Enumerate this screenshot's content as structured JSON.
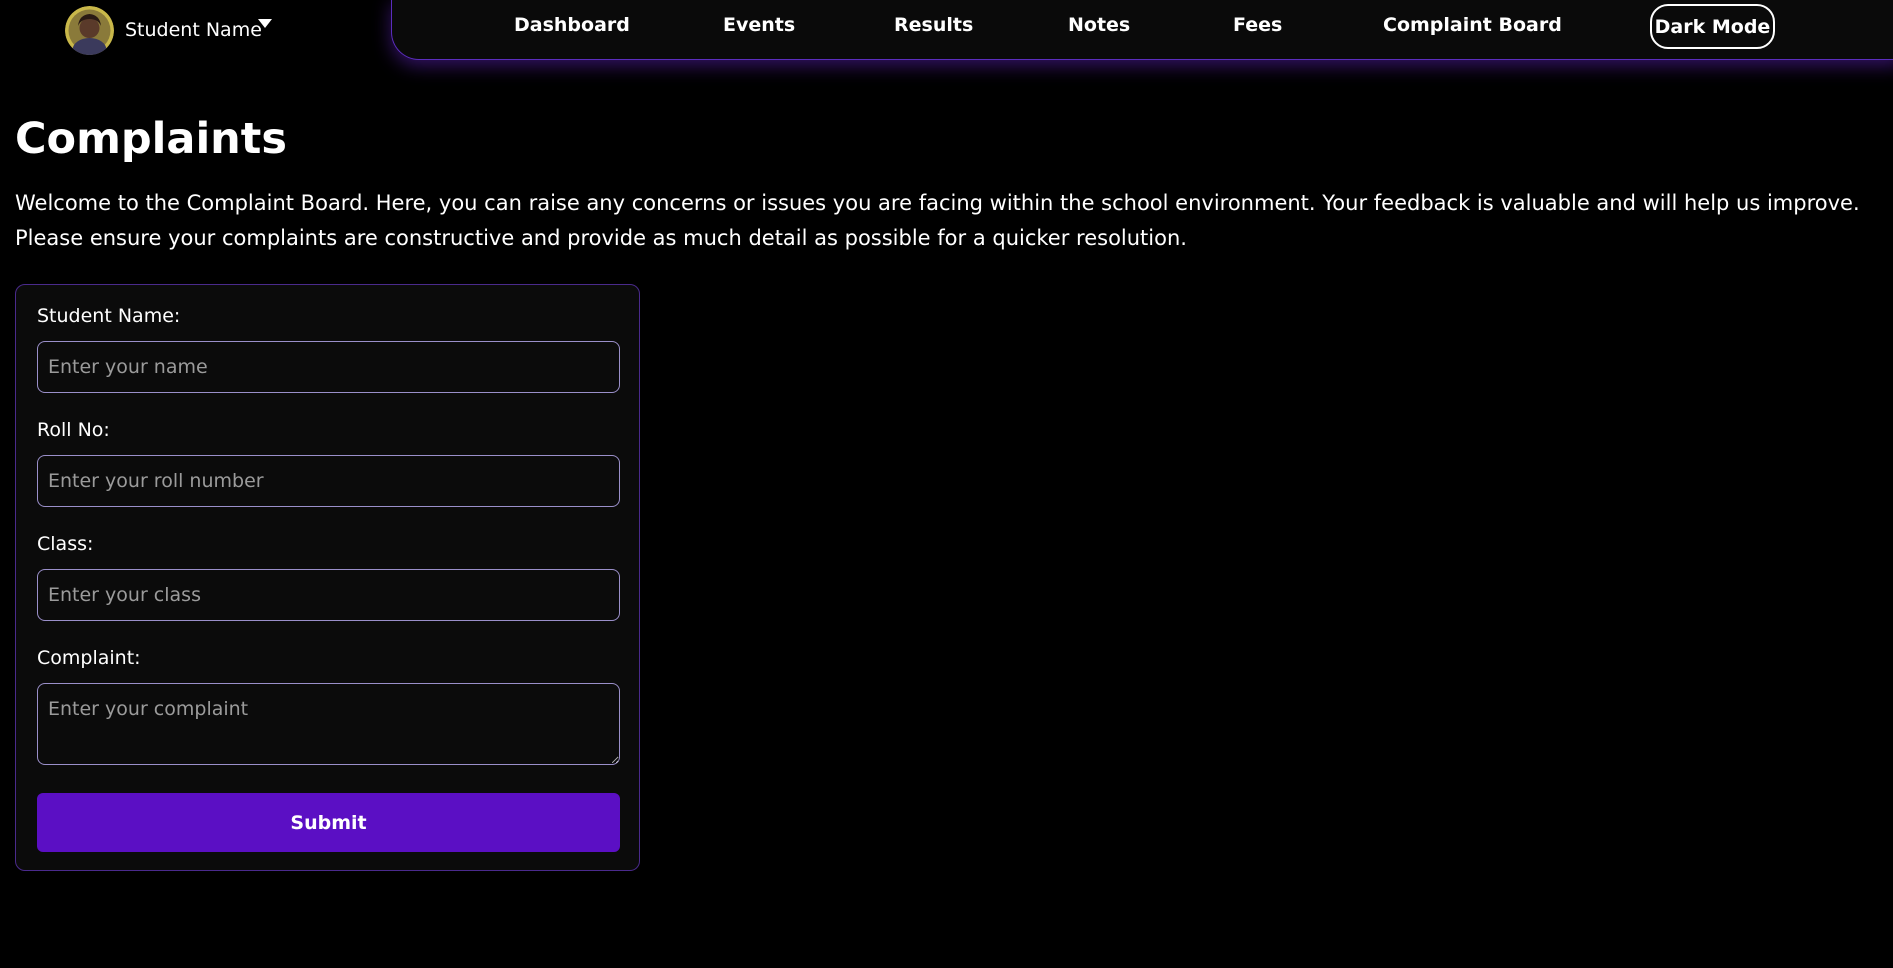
{
  "profile": {
    "name": "Student Name",
    "avatar_icon": "student-avatar-icon",
    "dropdown_icon": "caret-down-icon"
  },
  "nav": {
    "dashboard": "Dashboard",
    "events": "Events",
    "results": "Results",
    "notes": "Notes",
    "fees": "Fees",
    "complaint_board": "Complaint Board",
    "dark_mode": "Dark Mode"
  },
  "main": {
    "title": "Complaints",
    "intro": "Welcome to the Complaint Board. Here, you can raise any concerns or issues you are facing within the school environment. Your feedback is valuable and will help us improve. Please ensure your complaints are constructive and provide as much detail as possible for a quicker resolution."
  },
  "form": {
    "student_name": {
      "label": "Student Name:",
      "value": "",
      "placeholder": "Enter your name"
    },
    "roll_no": {
      "label": "Roll No:",
      "value": "",
      "placeholder": "Enter your roll number"
    },
    "class": {
      "label": "Class:",
      "value": "",
      "placeholder": "Enter your class"
    },
    "complaint": {
      "label": "Complaint:",
      "value": "",
      "placeholder": "Enter your complaint"
    },
    "submit_label": "Submit"
  },
  "colors": {
    "background": "#000000",
    "accent": "#5b0fc4",
    "navbar_border": "#5b2dbd",
    "input_border": "#9a8fc9"
  }
}
